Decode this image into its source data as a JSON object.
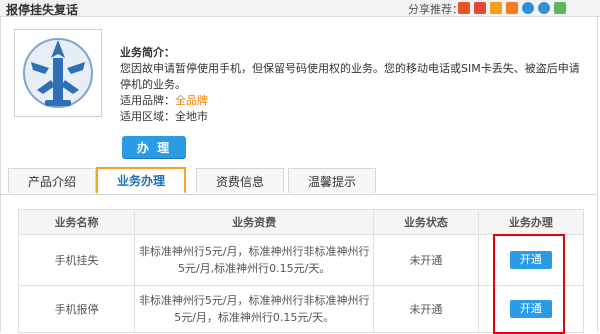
{
  "header": {
    "title": "报停挂失复话",
    "share_label": "分享推荐：",
    "share_icons": [
      "qzone-icon",
      "tencent-weibo-icon",
      "sina-weibo-icon",
      "renren-icon",
      "kaixin-icon",
      "douban-icon",
      "more-share-icon"
    ]
  },
  "product": {
    "intro_label": "业务简介：",
    "intro_text": "您因故申请暂停使用手机，但保留号码使用权的业务。您的移动电话或SIM卡丢失、被盗后申请停机的业务。",
    "brand_label": "适用品牌：",
    "brand_value": "全品牌",
    "region_label": "适用区域：",
    "region_value": "全地市",
    "apply_label": "办 理"
  },
  "tabs": [
    {
      "label": "产品介绍",
      "active": false
    },
    {
      "label": "业务办理",
      "active": true
    },
    {
      "label": "资费信息",
      "active": false
    },
    {
      "label": "温馨提示",
      "active": false
    }
  ],
  "table": {
    "headers": [
      "业务名称",
      "业务资费",
      "业务状态",
      "业务办理"
    ],
    "rows": [
      {
        "name": "手机挂失",
        "fee": "非标准神州行5元/月，标准神州行非标准神州行5元/月,标准神州行0.15元/天。",
        "status": "未开通",
        "action": "开通"
      },
      {
        "name": "手机报停",
        "fee": "非标准神州行5元/月，标准神州行非标准神州行5元/月，标准神州行0.15元/天。",
        "status": "未开通",
        "action": "开通"
      }
    ]
  },
  "colors": {
    "accent_blue": "#2b9be6",
    "highlight_orange": "#f08300",
    "tab_active_border": "#f5a623",
    "annotation_red": "#e60012"
  }
}
